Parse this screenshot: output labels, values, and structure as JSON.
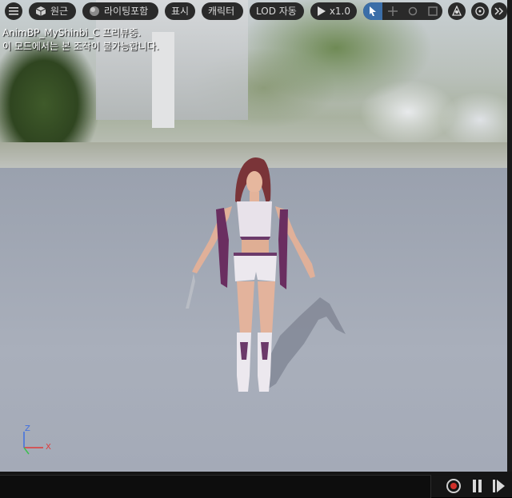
{
  "toolbar": {
    "perspective_label": "원근",
    "lighting_label": "라이팅포함",
    "show_label": "표시",
    "character_label": "캐릭터",
    "lod_label": "LOD 자동",
    "play_speed": "x1.0",
    "transform_tools": [
      "select-icon",
      "move-icon",
      "rotate-icon",
      "scale-icon"
    ],
    "active_tool": "select-icon",
    "accent_color": "#3b6ea8"
  },
  "viewport": {
    "status_line1": "AnimBP_MyShinbi_C 프리뷰중.",
    "status_line2": "이 모드에서는 본 조작이 불가능합니다.",
    "axis_z": "Z",
    "axis_x": "X"
  },
  "playback": {
    "record_color": "#d0302a"
  }
}
